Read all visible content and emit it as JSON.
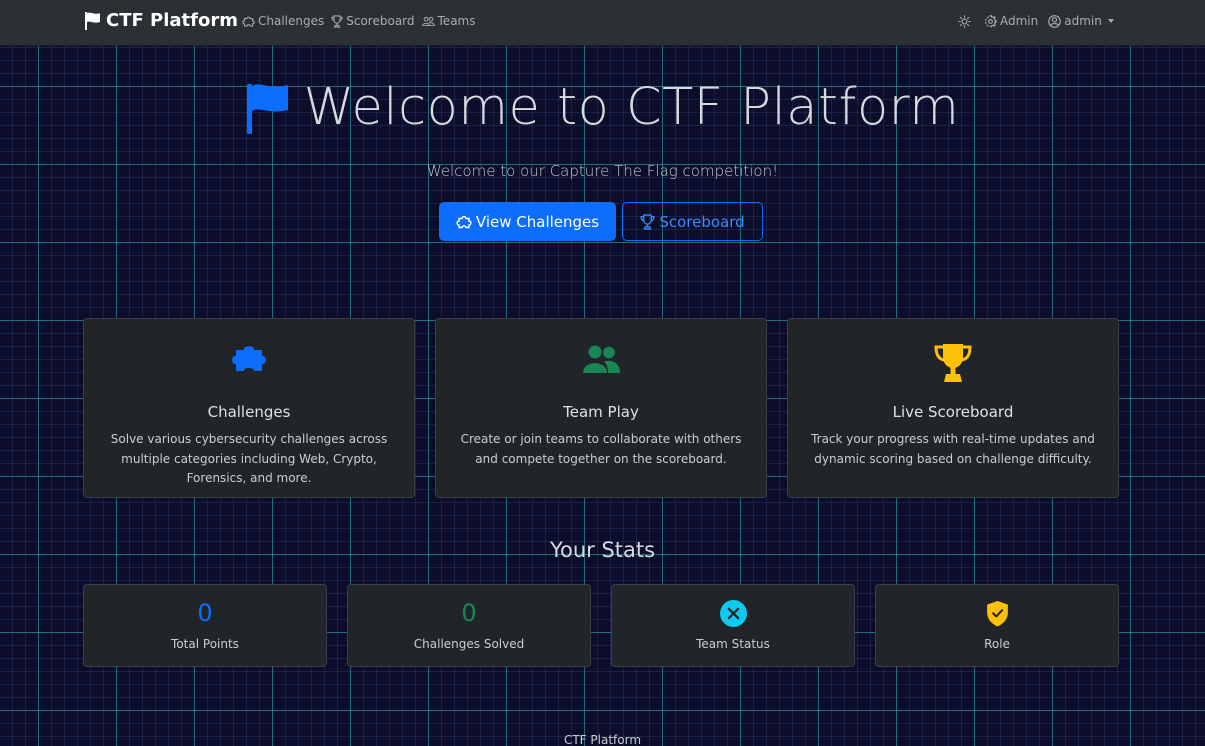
{
  "navbar": {
    "brand": "CTF Platform",
    "links": [
      {
        "label": "Challenges",
        "icon": "puzzle-icon"
      },
      {
        "label": "Scoreboard",
        "icon": "trophy-icon"
      },
      {
        "label": "Teams",
        "icon": "people-icon"
      }
    ],
    "theme_icon": "sun-icon",
    "admin_label": "Admin",
    "user_label": "admin"
  },
  "hero": {
    "title": "Welcome to CTF Platform",
    "subtitle": "Welcome to our Capture The Flag competition!",
    "primary_button": "View Challenges",
    "secondary_button": "Scoreboard"
  },
  "features": [
    {
      "title": "Challenges",
      "description": "Solve various cybersecurity challenges across multiple categories including Web, Crypto, Forensics, and more.",
      "icon": "puzzle-icon",
      "color": "#0d6efd"
    },
    {
      "title": "Team Play",
      "description": "Create or join teams to collaborate with others and compete together on the scoreboard.",
      "icon": "people-icon",
      "color": "#198754"
    },
    {
      "title": "Live Scoreboard",
      "description": "Track your progress with real-time updates and dynamic scoring based on challenge difficulty.",
      "icon": "trophy-icon",
      "color": "#ffc107"
    }
  ],
  "stats": {
    "title": "Your Stats",
    "items": [
      {
        "value": "0",
        "label": "Total Points",
        "color": "#0d6efd"
      },
      {
        "value": "0",
        "label": "Challenges Solved",
        "color": "#198754"
      },
      {
        "label": "Team Status",
        "icon": "x-circle-icon",
        "color": "#0dcaf0"
      },
      {
        "label": "Role",
        "icon": "shield-check-icon",
        "color": "#ffc107"
      }
    ]
  },
  "footer": "CTF Platform"
}
